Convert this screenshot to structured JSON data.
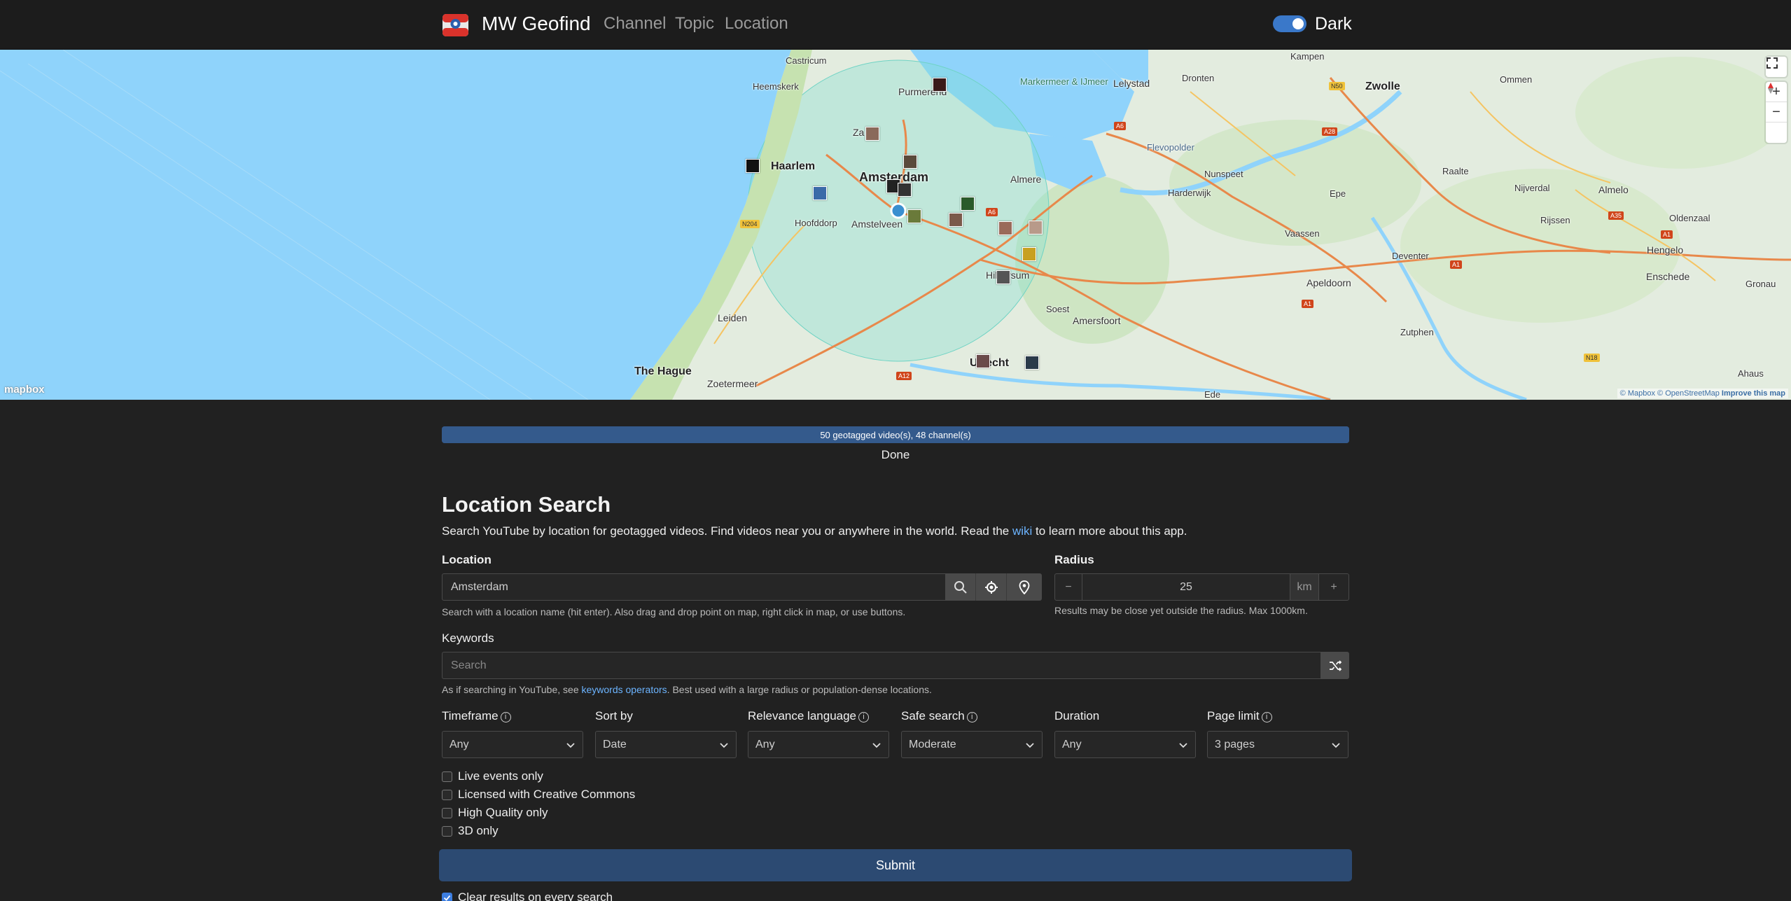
{
  "navbar": {
    "brand": "MW Geofind",
    "links": [
      "Channel",
      "Topic",
      "Location"
    ],
    "theme_label": "Dark"
  },
  "map": {
    "labels": {
      "castricum": "Castricum",
      "heemskerk": "Heemskerk",
      "purmerend": "Purmerend",
      "markermeer": "Markermeer & IJmeer",
      "lelystad": "Lelystad",
      "dronten": "Dronten",
      "kampen": "Kampen",
      "zwolle": "Zwolle",
      "ommen": "Ommen",
      "zaandam": "Za",
      "haarlem": "Haarlem",
      "amsterdam": "Amsterdam",
      "almere": "Almere",
      "flevopolder": "Flevopolder",
      "nunspeet": "Nunspeet",
      "raalte": "Raalte",
      "nijverdal": "Nijverdal",
      "almelo": "Almelo",
      "harderwijk": "Harderwijk",
      "epe": "Epe",
      "rijssen": "Rijssen",
      "oldenzaal": "Oldenzaal",
      "hoofddorp": "Hoofddorp",
      "amstelveen": "Amstelveen",
      "vaassen": "Vaassen",
      "hengelo": "Hengelo",
      "deventer": "Deventer",
      "enschede": "Enschede",
      "gronau": "Gronau",
      "hilversum": "Hilversum",
      "apeldoorn": "Apeldoorn",
      "leiden": "Leiden",
      "soest": "Soest",
      "amersfoort": "Amersfoort",
      "zutphen": "Zutphen",
      "the_hague": "The Hague",
      "zoetermeer": "Zoetermeer",
      "utrecht": "Utrecht",
      "ahaus": "Ahaus",
      "ede": "Ede"
    },
    "roads": [
      "N50",
      "A6",
      "A28",
      "N204",
      "A6",
      "A1",
      "A1",
      "A35",
      "A1",
      "A12",
      "N18"
    ],
    "controls": {
      "fullscreen": "fullscreen-icon",
      "zoom_in": "+",
      "zoom_out": "−",
      "compass": "compass-icon"
    },
    "logo": "mapbox",
    "attribution": {
      "mapbox": "© Mapbox",
      "osm": "© OpenStreetMap",
      "improve": "Improve this map"
    }
  },
  "progress": {
    "text": "50 geotagged video(s), 48 channel(s)",
    "status": "Done",
    "fraction": 1.0
  },
  "form": {
    "title": "Location Search",
    "intro_before": "Search YouTube by location for geotagged videos. Find videos near you or anywhere in the world. Read the ",
    "intro_link": "wiki",
    "intro_after": " to learn more about this app.",
    "location": {
      "label": "Location",
      "value": "Amsterdam",
      "help": "Search with a location name (hit enter). Also drag and drop point on map, right click in map, or use buttons."
    },
    "radius": {
      "label": "Radius",
      "value": "25",
      "unit": "km",
      "minus": "−",
      "plus": "+",
      "help": "Results may be close yet outside the radius. Max 1000km."
    },
    "keywords": {
      "label": "Keywords",
      "placeholder": "Search",
      "help_before": "As if searching in YouTube, see ",
      "help_link": "keywords operators",
      "help_after": ". Best used with a large radius or population-dense locations."
    },
    "selects": [
      {
        "label": "Timeframe",
        "value": "Any",
        "info": true
      },
      {
        "label": "Sort by",
        "value": "Date",
        "info": false
      },
      {
        "label": "Relevance language",
        "value": "Any",
        "info": true
      },
      {
        "label": "Safe search",
        "value": "Moderate",
        "info": true
      },
      {
        "label": "Duration",
        "value": "Any",
        "info": false
      },
      {
        "label": "Page limit",
        "value": "3 pages",
        "info": true
      }
    ],
    "checkboxes": [
      {
        "label": "Live events only",
        "checked": false
      },
      {
        "label": "Licensed with Creative Commons",
        "checked": false
      },
      {
        "label": "High Quality only",
        "checked": false
      },
      {
        "label": "3D only",
        "checked": false
      }
    ],
    "submit": "Submit",
    "clear_results": {
      "label": "Clear results on every search",
      "checked": true
    }
  },
  "colors": {
    "background": "#212121",
    "navbar": "#1c1c1c",
    "accent": "#3a78c9",
    "link": "#6cb4ff",
    "submit": "#2c4a72",
    "water": "#8fd3fb",
    "radius_circle": "#7fe0d2"
  }
}
